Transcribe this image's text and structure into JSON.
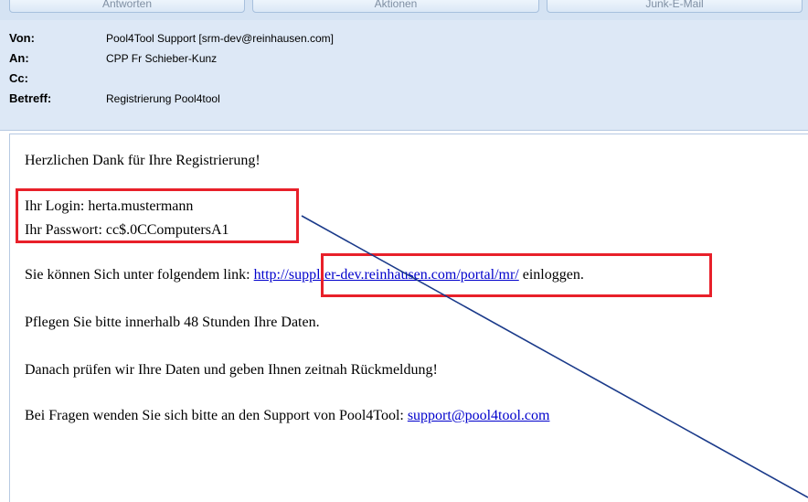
{
  "toolbar": {
    "reply_label": "Antworten",
    "actions_label": "Aktionen",
    "junk_label": "Junk-E-Mail"
  },
  "header": {
    "from_label": "Von:",
    "from_value": "Pool4Tool Support [srm-dev@reinhausen.com]",
    "to_label": "An:",
    "to_value": "CPP Fr Schieber-Kunz",
    "cc_label": "Cc:",
    "cc_value": "",
    "subject_label": "Betreff:",
    "subject_value": "Registrierung Pool4tool"
  },
  "message": {
    "greeting": "Herzlichen Dank für Ihre Registrierung!",
    "login_line": "Ihr Login: herta.mustermann",
    "password_line": "Ihr Passwort: cc$.0CComputersA1",
    "link_prefix": "Sie können Sich unter folgendem link: ",
    "link_url": "http://supplier-dev.reinhausen.com/portal/mr/",
    "link_suffix": " einloggen.",
    "maintain_line": "Pflegen Sie bitte innerhalb 48 Stunden Ihre Daten.",
    "review_line": "Danach prüfen wir Ihre Daten und geben Ihnen zeitnah Rückmeldung!",
    "support_prefix": "Bei Fragen wenden Sie sich bitte an den Support von Pool4Tool: ",
    "support_email": "support@pool4tool.com"
  },
  "colors": {
    "highlight": "#e8202a",
    "arrow": "#1a3a8a",
    "link": "#0000cc",
    "header_bg": "#dde8f6"
  }
}
